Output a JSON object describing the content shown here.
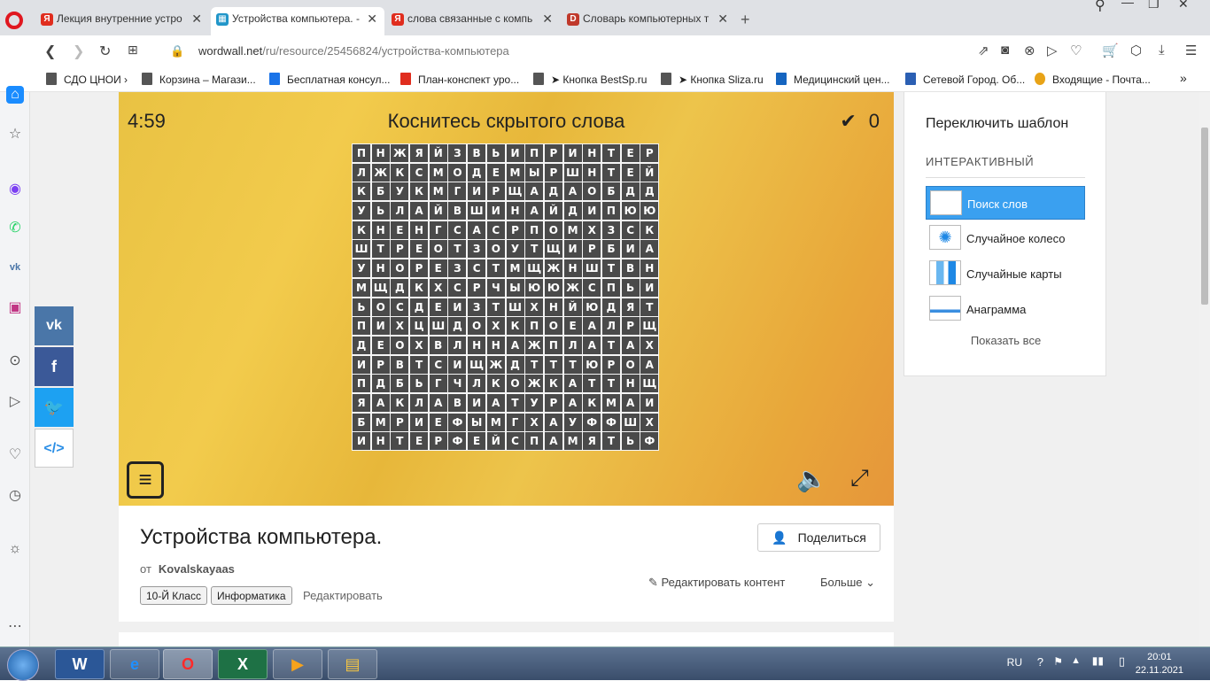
{
  "browser": {
    "tabs": [
      {
        "title": "Лекция внутренние устро",
        "favicon": "yandex-icon",
        "color": "#e02d1e",
        "glyph": "Я"
      },
      {
        "title": "Устройства компьютера. -",
        "favicon": "wordwall-icon",
        "color": "#2196c9",
        "glyph": "▦"
      },
      {
        "title": "слова связанные с компь",
        "favicon": "yandex-icon",
        "color": "#e02d1e",
        "glyph": "Я"
      },
      {
        "title": "Словарь компьютерных т",
        "favicon": "dictionary-icon",
        "color": "#c0392b",
        "glyph": "D"
      }
    ],
    "url_host": "wordwall.net",
    "url_path": "/ru/resource/25456824/устройства-компьютера",
    "bookmarks": [
      "СДО ЦНОИ ›",
      "Корзина – Магази...",
      "Бесплатная консул...",
      "План-конспект уро...",
      "➤ Кнопка BestSp.ru",
      "➤ Кнопка Sliza.ru",
      "Медицинский цен...",
      "Сетевой Город. Об...",
      "Входящие - Почта..."
    ]
  },
  "game": {
    "timer": "4:59",
    "instruction": "Коснитесь скрытого слова",
    "score": "0",
    "grid": [
      "ПНЖЯЙЗВЬИПРИНТЕР",
      "ЛЖКСМОДЕМЫРШНТЕЙ",
      "КБУКМГИРЩАДАОБДД",
      "УЬЛАЙВШИНАЙДИПЮЮ",
      "КНЕНГСАСРПОМХЗСК",
      "ШТРЕОТЗОУТЩИРБИА",
      "УНОРЕЗСТМЩЖНШТВН",
      "МЩДКХСРЧЫЮЮЖСПЬИ",
      "ЬОСДЕИЗТШХНЙЮДЯТ",
      "ПИХЦШДОХКПОЕАЛРЩ",
      "ДЕОХВЛННАЖПЛАТАХ",
      "ИРВТСИЩЖДТТТЮРОА",
      "ПДБЬГЧЛКОЖКАТТНЩ",
      "ЯАКЛАВИАТУРАКМАИ",
      "БМРИЕФЫМГХАУФФШХ",
      "ИНТЕРФЕЙСПАМЯТЬФ"
    ]
  },
  "activity": {
    "title": "Устройства компьютера.",
    "author_prefix": "от",
    "author": "Kovalskayaas",
    "tags": [
      "10-Й Класс",
      "Информатика"
    ],
    "edit": "Редактировать",
    "share": "Поделиться",
    "edit_content": "Редактировать контент",
    "more": "Больше"
  },
  "templates": {
    "title": "Переключить шаблон",
    "section": "ИНТЕРАКТИВНЫЙ",
    "items": [
      "Поиск слов",
      "Случайное колесо",
      "Случайные карты",
      "Анаграмма"
    ],
    "show_all": "Показать все"
  },
  "taskbar": {
    "lang": "RU",
    "time": "20:01",
    "date": "22.11.2021"
  }
}
